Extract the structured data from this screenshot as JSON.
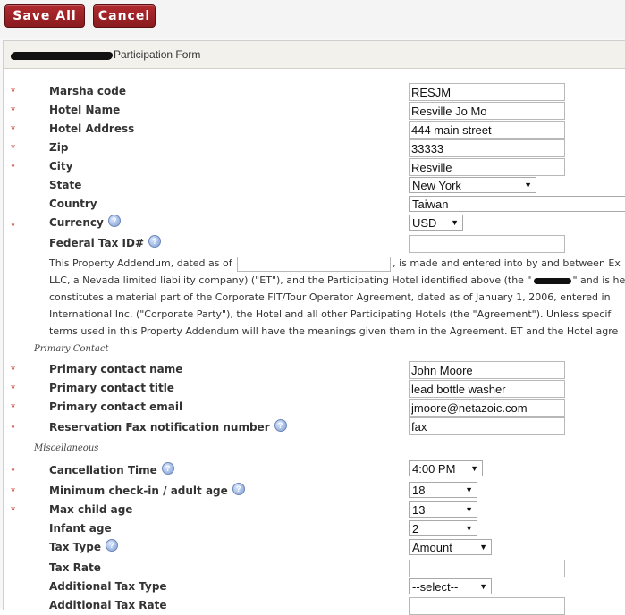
{
  "toolbar": {
    "save_label": "Save All",
    "cancel_label": "Cancel"
  },
  "panel": {
    "title": "Participation Form"
  },
  "fields": {
    "marsha": {
      "label": "Marsha code",
      "value": "RESJM"
    },
    "hotel_name": {
      "label": "Hotel Name",
      "value": "Resville Jo Mo"
    },
    "hotel_address": {
      "label": "Hotel Address",
      "value": "444 main street"
    },
    "zip": {
      "label": "Zip",
      "value": "33333"
    },
    "city": {
      "label": "City",
      "value": "Resville"
    },
    "state": {
      "label": "State",
      "value": "New York"
    },
    "country": {
      "label": "Country",
      "value": "Taiwan"
    },
    "currency": {
      "label": "Currency",
      "value": "USD"
    },
    "tax_id": {
      "label": "Federal Tax ID#",
      "value": ""
    },
    "contact_name": {
      "label": "Primary contact name",
      "value": "John Moore"
    },
    "contact_title": {
      "label": "Primary contact title",
      "value": "lead bottle washer"
    },
    "contact_email": {
      "label": "Primary contact email",
      "value": "jmoore@netazoic.com"
    },
    "fax": {
      "label": "Reservation Fax notification number",
      "value": "fax"
    },
    "cancel_time": {
      "label": "Cancellation Time",
      "value": "4:00 PM"
    },
    "min_age": {
      "label": "Minimum check-in / adult age",
      "value": "18"
    },
    "max_child": {
      "label": "Max child age",
      "value": "13"
    },
    "infant_age": {
      "label": "Infant age",
      "value": "2"
    },
    "tax_type": {
      "label": "Tax Type",
      "value": "Amount"
    },
    "tax_rate": {
      "label": "Tax Rate",
      "value": ""
    },
    "add_tax_type": {
      "label": "Additional Tax Type",
      "value": "--select--"
    },
    "add_tax_rate": {
      "label": "Additional Tax Rate",
      "value": ""
    }
  },
  "sections": {
    "primary_contact": "Primary Contact",
    "misc": "Miscellaneous"
  },
  "addendum": {
    "l1_a": "This Property Addendum, dated as of",
    "l1_b": ", is made and entered into by and between Ex",
    "l2_a": "LLC, a Nevada limited liability company) (\"ET\"), and the Participating Hotel identified above (the \"",
    "l2_b": "\" and is her",
    "l3": "constitutes a material part of the Corporate FIT/Tour Operator Agreement, dated as of January 1, 2006, entered in",
    "l4": "International Inc. (\"Corporate Party\"), the Hotel and all other Participating Hotels (the \"Agreement\"). Unless specif",
    "l5": "terms used in this Property Addendum will have the meanings given them in the Agreement. ET and the Hotel agre"
  },
  "icons": {
    "help": "help-icon",
    "dropdown": "chevron-down-icon",
    "required": "required-asterisk"
  },
  "colors": {
    "button": "#9c2226",
    "required": "#c8342d",
    "help": "#7f9fd2"
  }
}
